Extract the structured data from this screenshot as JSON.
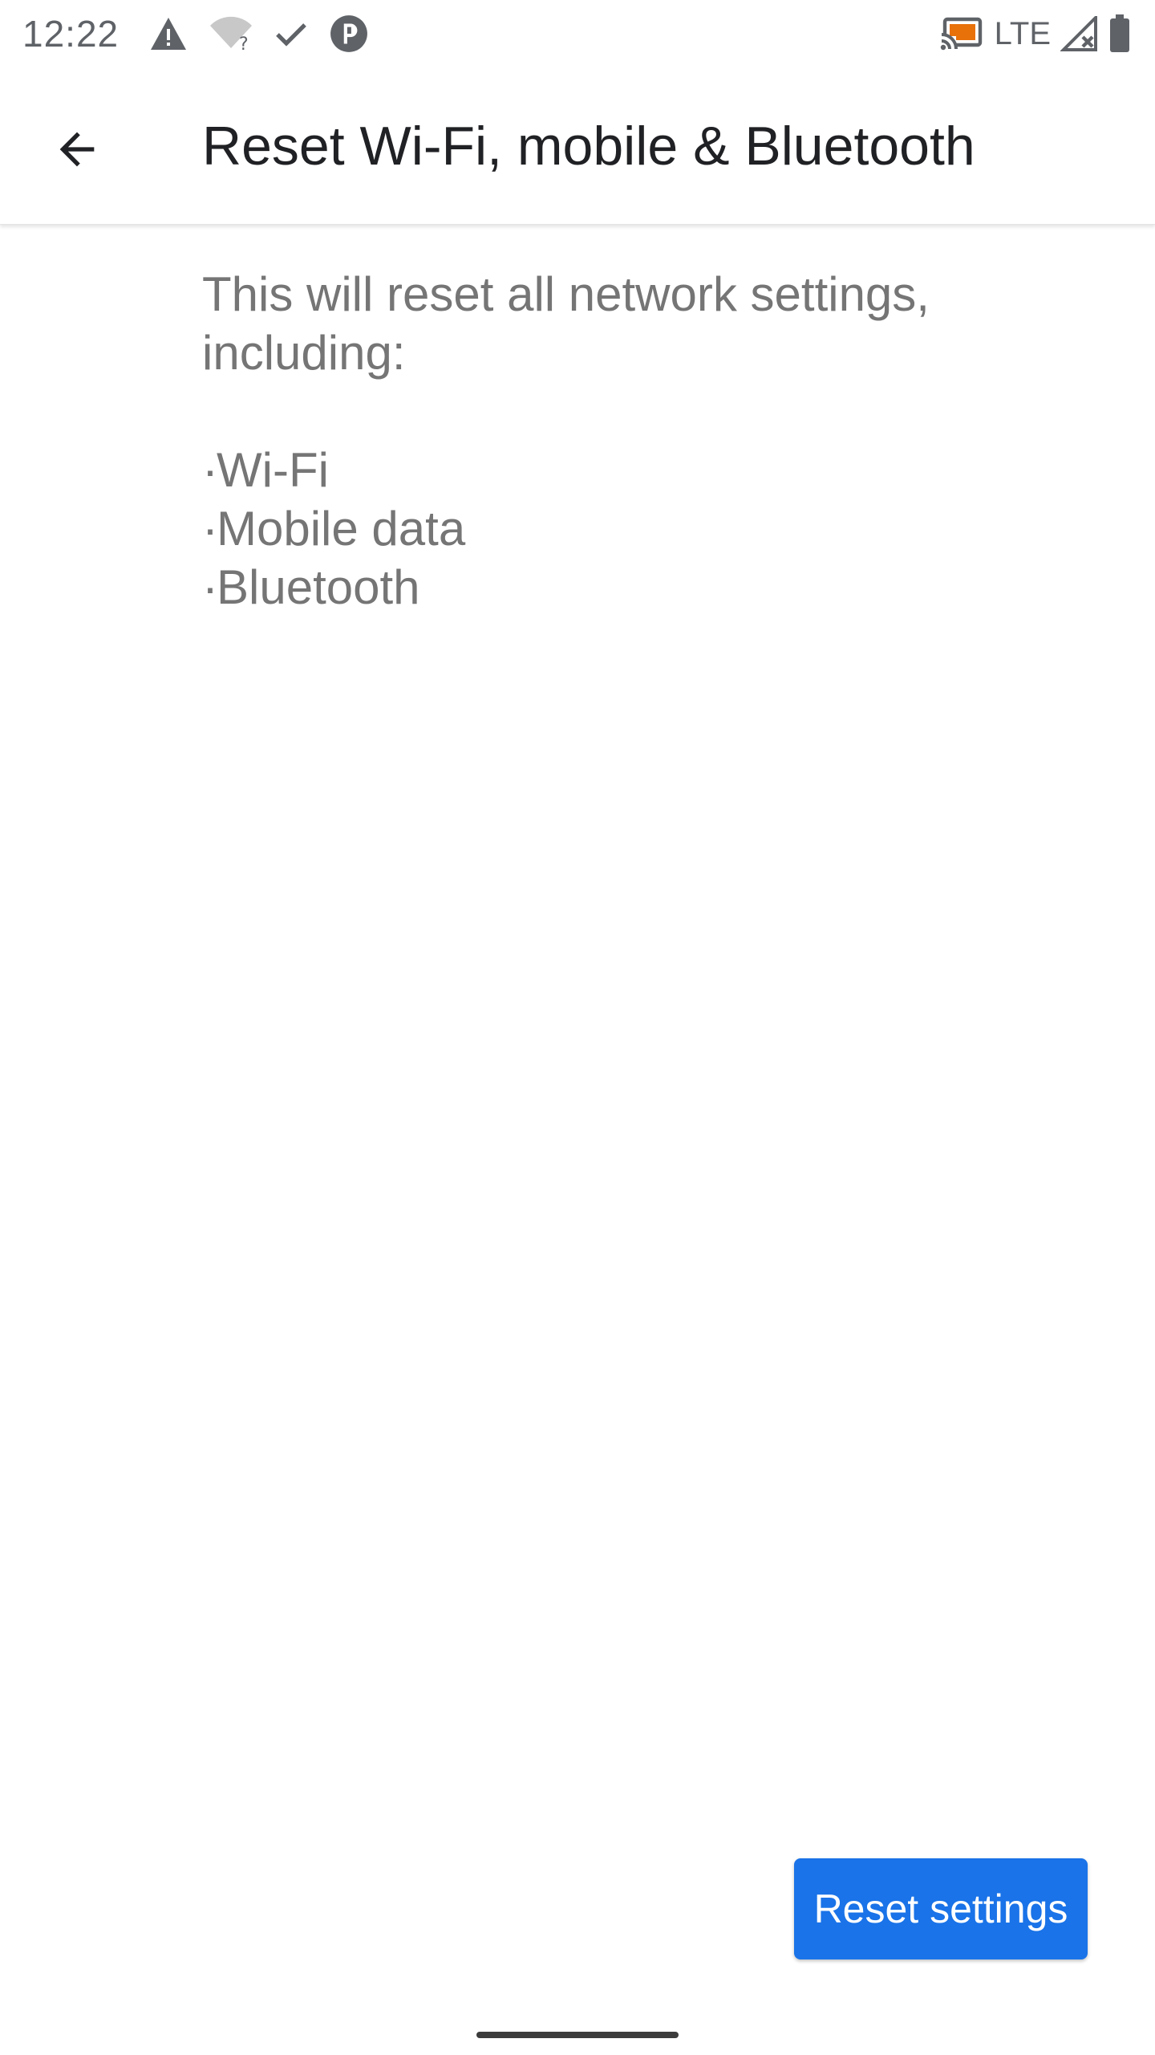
{
  "status_bar": {
    "time": "12:22",
    "left_icons": [
      "warning-icon",
      "wifi-unknown-icon",
      "check-icon",
      "app-notification-icon"
    ],
    "network_label": "LTE",
    "right_icons": [
      "cast-icon",
      "signal-no-service-icon",
      "battery-icon"
    ],
    "cast_color": "#e8710a"
  },
  "app_bar": {
    "title": "Reset Wi-Fi, mobile & Bluetooth",
    "back_icon": "arrow-back-icon"
  },
  "content": {
    "description": "This will reset all network settings, including:",
    "items": [
      {
        "bullet": "·",
        "label": "Wi-Fi"
      },
      {
        "bullet": "·",
        "label": "Mobile data"
      },
      {
        "bullet": "·",
        "label": "Bluetooth"
      }
    ]
  },
  "actions": {
    "reset_label": "Reset settings",
    "accent_color": "#1a73e8"
  }
}
